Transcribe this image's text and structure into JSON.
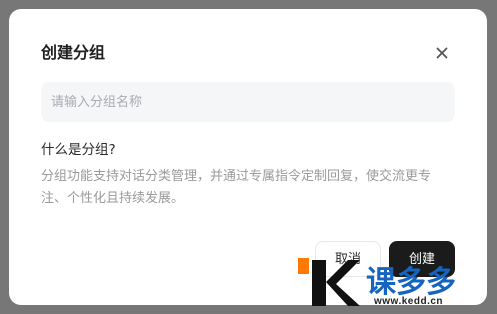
{
  "dialog": {
    "title": "创建分组",
    "close_icon": "close-icon",
    "input": {
      "value": "",
      "placeholder": "请输入分组名称"
    },
    "info": {
      "question": "什么是分组?",
      "description": "分组功能支持对话分类管理，并通过专属指令定制回复，使交流更专注、个性化且持续发展。"
    },
    "buttons": {
      "cancel_label": "取消",
      "create_label": "创建"
    }
  },
  "watermark": {
    "brand_text": "课多多",
    "url": "www.kedd.cn",
    "accent_color": "#ff7a00",
    "brand_color": "#1565c0"
  },
  "colors": {
    "backdrop": "#777777",
    "primary_button": "#1b1b1b",
    "input_background": "#f5f6f8"
  }
}
